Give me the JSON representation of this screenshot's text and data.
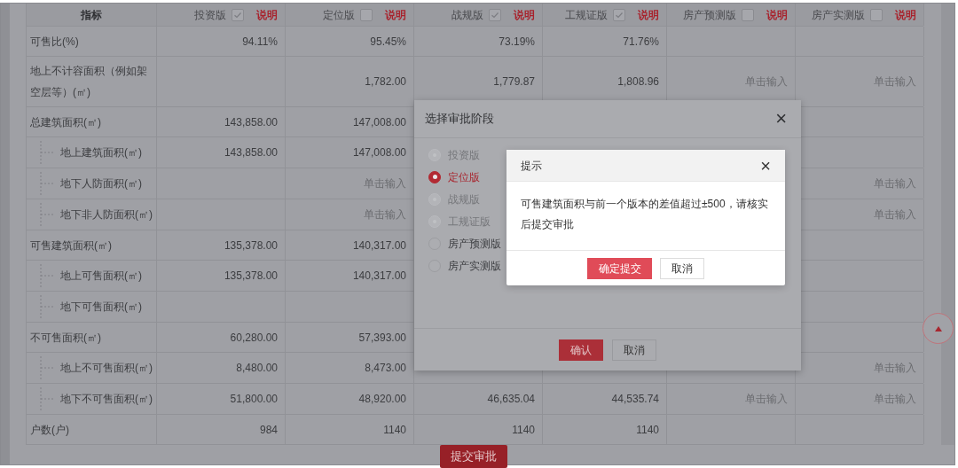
{
  "table": {
    "columns": [
      {
        "label": "指标"
      },
      {
        "label": "投资版",
        "checked": true,
        "note": "说明"
      },
      {
        "label": "定位版",
        "checked": false,
        "note": "说明"
      },
      {
        "label": "战规版",
        "checked": true,
        "note": "说明"
      },
      {
        "label": "工规证版",
        "checked": true,
        "note": "说明"
      },
      {
        "label": "房产预测版",
        "checked": false,
        "note": "说明"
      },
      {
        "label": "房产实测版",
        "checked": false,
        "note": "说明"
      }
    ],
    "rows": [
      {
        "cells": [
          {
            "kind": "label",
            "text": "可售比(%)"
          },
          {
            "kind": "value",
            "text": "94.11%"
          },
          {
            "kind": "value",
            "text": "95.45%"
          },
          {
            "kind": "value",
            "text": "73.19%"
          },
          {
            "kind": "value",
            "text": "71.76%"
          },
          {
            "kind": "blank"
          },
          {
            "kind": "blank"
          }
        ]
      },
      {
        "cells": [
          {
            "kind": "label",
            "text": "地上不计容面积（例如架空层等）(㎡)"
          },
          {
            "kind": "blank"
          },
          {
            "kind": "value",
            "text": "1,782.00"
          },
          {
            "kind": "value",
            "text": "1,779.87"
          },
          {
            "kind": "value",
            "text": "1,808.96"
          },
          {
            "kind": "prompt",
            "text": "单击输入"
          },
          {
            "kind": "prompt",
            "text": "单击输入"
          }
        ]
      },
      {
        "cells": [
          {
            "kind": "label",
            "text": "总建筑面积(㎡)"
          },
          {
            "kind": "value",
            "text": "143,858.00"
          },
          {
            "kind": "value",
            "text": "147,008.00"
          },
          {
            "kind": "blank"
          },
          {
            "kind": "blank"
          },
          {
            "kind": "blank"
          },
          {
            "kind": "blank"
          }
        ],
        "children": [
          {
            "cells": [
              {
                "kind": "label",
                "text": "地上建筑面积(㎡)"
              },
              {
                "kind": "value",
                "text": "143,858.00"
              },
              {
                "kind": "value",
                "text": "147,008.00"
              },
              {
                "kind": "blank"
              },
              {
                "kind": "blank"
              },
              {
                "kind": "blank"
              },
              {
                "kind": "blank"
              }
            ]
          },
          {
            "cells": [
              {
                "kind": "label",
                "text": "地下人防面积(㎡)"
              },
              {
                "kind": "blank"
              },
              {
                "kind": "prompt",
                "text": "单击输入"
              },
              {
                "kind": "blank"
              },
              {
                "kind": "blank"
              },
              {
                "kind": "blank"
              },
              {
                "kind": "prompt",
                "text": "单击输入"
              }
            ]
          },
          {
            "cells": [
              {
                "kind": "label",
                "text": "地下非人防面积(㎡)"
              },
              {
                "kind": "blank"
              },
              {
                "kind": "prompt",
                "text": "单击输入"
              },
              {
                "kind": "blank"
              },
              {
                "kind": "blank"
              },
              {
                "kind": "blank"
              },
              {
                "kind": "prompt",
                "text": "单击输入"
              }
            ]
          }
        ]
      },
      {
        "cells": [
          {
            "kind": "label",
            "text": "可售建筑面积(㎡)"
          },
          {
            "kind": "value",
            "text": "135,378.00"
          },
          {
            "kind": "value",
            "text": "140,317.00"
          },
          {
            "kind": "blank"
          },
          {
            "kind": "blank"
          },
          {
            "kind": "blank"
          },
          {
            "kind": "blank"
          }
        ],
        "children": [
          {
            "cells": [
              {
                "kind": "label",
                "text": "地上可售面积(㎡)"
              },
              {
                "kind": "value",
                "text": "135,378.00"
              },
              {
                "kind": "value",
                "text": "140,317.00"
              },
              {
                "kind": "blank"
              },
              {
                "kind": "blank"
              },
              {
                "kind": "blank"
              },
              {
                "kind": "blank"
              }
            ]
          },
          {
            "cells": [
              {
                "kind": "label",
                "text": "地下可售面积(㎡)"
              },
              {
                "kind": "blank"
              },
              {
                "kind": "blank"
              },
              {
                "kind": "blank"
              },
              {
                "kind": "blank"
              },
              {
                "kind": "blank"
              },
              {
                "kind": "blank"
              }
            ]
          }
        ]
      },
      {
        "cells": [
          {
            "kind": "label",
            "text": "不可售面积(㎡)"
          },
          {
            "kind": "value",
            "text": "60,280.00"
          },
          {
            "kind": "value",
            "text": "57,393.00"
          },
          {
            "kind": "blank"
          },
          {
            "kind": "blank"
          },
          {
            "kind": "blank"
          },
          {
            "kind": "blank"
          }
        ],
        "children": [
          {
            "cells": [
              {
                "kind": "label",
                "text": "地上不可售面积(㎡)"
              },
              {
                "kind": "value",
                "text": "8,480.00"
              },
              {
                "kind": "value",
                "text": "8,473.00"
              },
              {
                "kind": "blank"
              },
              {
                "kind": "blank"
              },
              {
                "kind": "blank"
              },
              {
                "kind": "prompt",
                "text": "单击输入"
              }
            ]
          },
          {
            "cells": [
              {
                "kind": "label",
                "text": "地下不可售面积(㎡)"
              },
              {
                "kind": "value",
                "text": "51,800.00"
              },
              {
                "kind": "value",
                "text": "48,920.00"
              },
              {
                "kind": "value",
                "text": "46,635.04"
              },
              {
                "kind": "value",
                "text": "44,535.74"
              },
              {
                "kind": "prompt",
                "text": "单击输入"
              },
              {
                "kind": "prompt",
                "text": "单击输入"
              }
            ]
          }
        ]
      },
      {
        "cells": [
          {
            "kind": "label",
            "text": "户数(户)"
          },
          {
            "kind": "value",
            "text": "984"
          },
          {
            "kind": "value",
            "text": "1140"
          },
          {
            "kind": "value",
            "text": "1140"
          },
          {
            "kind": "value",
            "text": "1140"
          },
          {
            "kind": "blank"
          },
          {
            "kind": "blank"
          }
        ]
      }
    ]
  },
  "submit_button": "提交审批",
  "stage_dialog": {
    "title": "选择审批阶段",
    "close": "×",
    "options": [
      {
        "label": "投资版",
        "selected": false,
        "disabled": true
      },
      {
        "label": "定位版",
        "selected": true,
        "disabled": false
      },
      {
        "label": "战规版",
        "selected": false,
        "disabled": true
      },
      {
        "label": "工规证版",
        "selected": false,
        "disabled": true
      },
      {
        "label": "房产预测版",
        "selected": false,
        "disabled": false
      },
      {
        "label": "房产实测版",
        "selected": false,
        "disabled": false
      }
    ],
    "buttons": [
      "确认",
      "取消"
    ]
  },
  "alert_dialog": {
    "title": "提示",
    "close": "×",
    "message": "可售建筑面积与前一个版本的差值超过±500，请核实后提交审批",
    "buttons": [
      "确定提交",
      "取消"
    ]
  }
}
